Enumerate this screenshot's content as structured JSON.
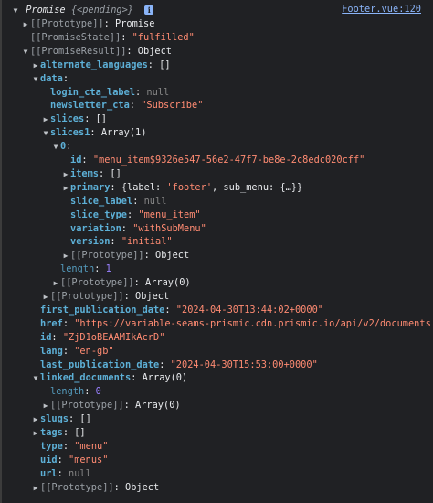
{
  "source_link": "Footer.vue:120",
  "header": {
    "label": "Promise",
    "state_preview": "{<pending>}",
    "info_icon_glyph": "i"
  },
  "rows": [
    {
      "indent": 1,
      "tri": "right",
      "parts": [
        {
          "t": "[[Prototype]]",
          "c": "internal"
        },
        {
          "t": ": ",
          "c": "punct"
        },
        {
          "t": "Promise",
          "c": "obj"
        }
      ]
    },
    {
      "indent": 1,
      "tri": "none",
      "parts": [
        {
          "t": "[[PromiseState]]",
          "c": "internal"
        },
        {
          "t": ": ",
          "c": "punct"
        },
        {
          "t": "\"fulfilled\"",
          "c": "str"
        }
      ]
    },
    {
      "indent": 1,
      "tri": "down",
      "parts": [
        {
          "t": "[[PromiseResult]]",
          "c": "internal"
        },
        {
          "t": ": ",
          "c": "punct"
        },
        {
          "t": "Object",
          "c": "obj"
        }
      ]
    },
    {
      "indent": 2,
      "tri": "right",
      "parts": [
        {
          "t": "alternate_languages",
          "c": "key"
        },
        {
          "t": ": ",
          "c": "punct"
        },
        {
          "t": "[]",
          "c": "obj"
        }
      ]
    },
    {
      "indent": 2,
      "tri": "down",
      "parts": [
        {
          "t": "data",
          "c": "key"
        },
        {
          "t": ":",
          "c": "punct"
        }
      ]
    },
    {
      "indent": 3,
      "tri": "none",
      "parts": [
        {
          "t": "login_cta_label",
          "c": "key"
        },
        {
          "t": ": ",
          "c": "punct"
        },
        {
          "t": "null",
          "c": "null"
        }
      ]
    },
    {
      "indent": 3,
      "tri": "none",
      "parts": [
        {
          "t": "newsletter_cta",
          "c": "key"
        },
        {
          "t": ": ",
          "c": "punct"
        },
        {
          "t": "\"Subscribe\"",
          "c": "str"
        }
      ]
    },
    {
      "indent": 3,
      "tri": "right",
      "parts": [
        {
          "t": "slices",
          "c": "key"
        },
        {
          "t": ": ",
          "c": "punct"
        },
        {
          "t": "[]",
          "c": "obj"
        }
      ]
    },
    {
      "indent": 3,
      "tri": "down",
      "parts": [
        {
          "t": "slices1",
          "c": "key"
        },
        {
          "t": ": ",
          "c": "punct"
        },
        {
          "t": "Array(1)",
          "c": "obj"
        }
      ]
    },
    {
      "indent": 4,
      "tri": "down",
      "parts": [
        {
          "t": "0",
          "c": "key"
        },
        {
          "t": ":",
          "c": "punct"
        }
      ]
    },
    {
      "indent": 5,
      "tri": "none",
      "parts": [
        {
          "t": "id",
          "c": "key"
        },
        {
          "t": ": ",
          "c": "punct"
        },
        {
          "t": "\"menu_item$9326e547-56e2-47f7-be8e-2c8edc020cff\"",
          "c": "str"
        }
      ]
    },
    {
      "indent": 5,
      "tri": "right",
      "parts": [
        {
          "t": "items",
          "c": "key"
        },
        {
          "t": ": ",
          "c": "punct"
        },
        {
          "t": "[]",
          "c": "obj"
        }
      ]
    },
    {
      "indent": 5,
      "tri": "right",
      "parts": [
        {
          "t": "primary",
          "c": "key"
        },
        {
          "t": ": ",
          "c": "punct"
        },
        {
          "t": "{label: ",
          "c": "obj"
        },
        {
          "t": "'footer'",
          "c": "str"
        },
        {
          "t": ", sub_menu: {…}}",
          "c": "obj"
        }
      ]
    },
    {
      "indent": 5,
      "tri": "none",
      "parts": [
        {
          "t": "slice_label",
          "c": "key"
        },
        {
          "t": ": ",
          "c": "punct"
        },
        {
          "t": "null",
          "c": "null"
        }
      ]
    },
    {
      "indent": 5,
      "tri": "none",
      "parts": [
        {
          "t": "slice_type",
          "c": "key"
        },
        {
          "t": ": ",
          "c": "punct"
        },
        {
          "t": "\"menu_item\"",
          "c": "str"
        }
      ]
    },
    {
      "indent": 5,
      "tri": "none",
      "parts": [
        {
          "t": "variation",
          "c": "key"
        },
        {
          "t": ": ",
          "c": "punct"
        },
        {
          "t": "\"withSubMenu\"",
          "c": "str"
        }
      ]
    },
    {
      "indent": 5,
      "tri": "none",
      "parts": [
        {
          "t": "version",
          "c": "key"
        },
        {
          "t": ": ",
          "c": "punct"
        },
        {
          "t": "\"initial\"",
          "c": "str"
        }
      ]
    },
    {
      "indent": 5,
      "tri": "right",
      "parts": [
        {
          "t": "[[Prototype]]",
          "c": "internal"
        },
        {
          "t": ": ",
          "c": "punct"
        },
        {
          "t": "Object",
          "c": "obj"
        }
      ]
    },
    {
      "indent": 4,
      "tri": "none",
      "parts": [
        {
          "t": "length",
          "c": "key-dim"
        },
        {
          "t": ": ",
          "c": "punct"
        },
        {
          "t": "1",
          "c": "num"
        }
      ]
    },
    {
      "indent": 4,
      "tri": "right",
      "parts": [
        {
          "t": "[[Prototype]]",
          "c": "internal"
        },
        {
          "t": ": ",
          "c": "punct"
        },
        {
          "t": "Array(0)",
          "c": "obj"
        }
      ]
    },
    {
      "indent": 3,
      "tri": "right",
      "parts": [
        {
          "t": "[[Prototype]]",
          "c": "internal"
        },
        {
          "t": ": ",
          "c": "punct"
        },
        {
          "t": "Object",
          "c": "obj"
        }
      ]
    },
    {
      "indent": 2,
      "tri": "none",
      "parts": [
        {
          "t": "first_publication_date",
          "c": "key"
        },
        {
          "t": ": ",
          "c": "punct"
        },
        {
          "t": "\"2024-04-30T13:44:02+0000\"",
          "c": "str"
        }
      ]
    },
    {
      "indent": 2,
      "tri": "none",
      "parts": [
        {
          "t": "href",
          "c": "key"
        },
        {
          "t": ": ",
          "c": "punct"
        },
        {
          "t": "\"https://variable-seams-prismic.cdn.prismic.io/api/v2/documents",
          "c": "str"
        }
      ]
    },
    {
      "indent": 2,
      "tri": "none",
      "parts": [
        {
          "t": "id",
          "c": "key"
        },
        {
          "t": ": ",
          "c": "punct"
        },
        {
          "t": "\"ZjD1oBEAAMIkAcrD\"",
          "c": "str"
        }
      ]
    },
    {
      "indent": 2,
      "tri": "none",
      "parts": [
        {
          "t": "lang",
          "c": "key"
        },
        {
          "t": ": ",
          "c": "punct"
        },
        {
          "t": "\"en-gb\"",
          "c": "str"
        }
      ]
    },
    {
      "indent": 2,
      "tri": "none",
      "parts": [
        {
          "t": "last_publication_date",
          "c": "key"
        },
        {
          "t": ": ",
          "c": "punct"
        },
        {
          "t": "\"2024-04-30T15:53:00+0000\"",
          "c": "str"
        }
      ]
    },
    {
      "indent": 2,
      "tri": "down",
      "parts": [
        {
          "t": "linked_documents",
          "c": "key"
        },
        {
          "t": ": ",
          "c": "punct"
        },
        {
          "t": "Array(0)",
          "c": "obj"
        }
      ]
    },
    {
      "indent": 3,
      "tri": "none",
      "parts": [
        {
          "t": "length",
          "c": "key-dim"
        },
        {
          "t": ": ",
          "c": "punct"
        },
        {
          "t": "0",
          "c": "num"
        }
      ]
    },
    {
      "indent": 3,
      "tri": "right",
      "parts": [
        {
          "t": "[[Prototype]]",
          "c": "internal"
        },
        {
          "t": ": ",
          "c": "punct"
        },
        {
          "t": "Array(0)",
          "c": "obj"
        }
      ]
    },
    {
      "indent": 2,
      "tri": "right",
      "parts": [
        {
          "t": "slugs",
          "c": "key"
        },
        {
          "t": ": ",
          "c": "punct"
        },
        {
          "t": "[]",
          "c": "obj"
        }
      ]
    },
    {
      "indent": 2,
      "tri": "right",
      "parts": [
        {
          "t": "tags",
          "c": "key"
        },
        {
          "t": ": ",
          "c": "punct"
        },
        {
          "t": "[]",
          "c": "obj"
        }
      ]
    },
    {
      "indent": 2,
      "tri": "none",
      "parts": [
        {
          "t": "type",
          "c": "key"
        },
        {
          "t": ": ",
          "c": "punct"
        },
        {
          "t": "\"menu\"",
          "c": "str"
        }
      ]
    },
    {
      "indent": 2,
      "tri": "none",
      "parts": [
        {
          "t": "uid",
          "c": "key"
        },
        {
          "t": ": ",
          "c": "punct"
        },
        {
          "t": "\"menus\"",
          "c": "str"
        }
      ]
    },
    {
      "indent": 2,
      "tri": "none",
      "parts": [
        {
          "t": "url",
          "c": "key"
        },
        {
          "t": ": ",
          "c": "punct"
        },
        {
          "t": "null",
          "c": "null"
        }
      ]
    },
    {
      "indent": 2,
      "tri": "right",
      "parts": [
        {
          "t": "[[Prototype]]",
          "c": "internal"
        },
        {
          "t": ": ",
          "c": "punct"
        },
        {
          "t": "Object",
          "c": "obj"
        }
      ]
    }
  ],
  "colors": {
    "background": "#202124",
    "key": "#5db0d7",
    "string": "#ff8b72",
    "number": "#9980ff",
    "null": "#868686",
    "link": "#8ab4f8"
  }
}
